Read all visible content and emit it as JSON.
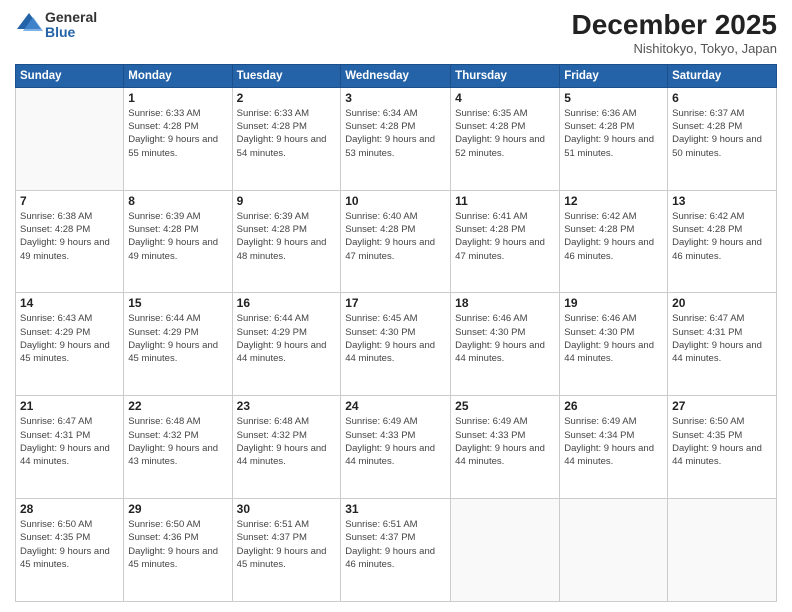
{
  "logo": {
    "general": "General",
    "blue": "Blue"
  },
  "header": {
    "month": "December 2025",
    "location": "Nishitokyo, Tokyo, Japan"
  },
  "weekdays": [
    "Sunday",
    "Monday",
    "Tuesday",
    "Wednesday",
    "Thursday",
    "Friday",
    "Saturday"
  ],
  "weeks": [
    [
      {
        "day": "",
        "sunrise": "",
        "sunset": "",
        "daylight": ""
      },
      {
        "day": "1",
        "sunrise": "Sunrise: 6:33 AM",
        "sunset": "Sunset: 4:28 PM",
        "daylight": "Daylight: 9 hours and 55 minutes."
      },
      {
        "day": "2",
        "sunrise": "Sunrise: 6:33 AM",
        "sunset": "Sunset: 4:28 PM",
        "daylight": "Daylight: 9 hours and 54 minutes."
      },
      {
        "day": "3",
        "sunrise": "Sunrise: 6:34 AM",
        "sunset": "Sunset: 4:28 PM",
        "daylight": "Daylight: 9 hours and 53 minutes."
      },
      {
        "day": "4",
        "sunrise": "Sunrise: 6:35 AM",
        "sunset": "Sunset: 4:28 PM",
        "daylight": "Daylight: 9 hours and 52 minutes."
      },
      {
        "day": "5",
        "sunrise": "Sunrise: 6:36 AM",
        "sunset": "Sunset: 4:28 PM",
        "daylight": "Daylight: 9 hours and 51 minutes."
      },
      {
        "day": "6",
        "sunrise": "Sunrise: 6:37 AM",
        "sunset": "Sunset: 4:28 PM",
        "daylight": "Daylight: 9 hours and 50 minutes."
      }
    ],
    [
      {
        "day": "7",
        "sunrise": "Sunrise: 6:38 AM",
        "sunset": "Sunset: 4:28 PM",
        "daylight": "Daylight: 9 hours and 49 minutes."
      },
      {
        "day": "8",
        "sunrise": "Sunrise: 6:39 AM",
        "sunset": "Sunset: 4:28 PM",
        "daylight": "Daylight: 9 hours and 49 minutes."
      },
      {
        "day": "9",
        "sunrise": "Sunrise: 6:39 AM",
        "sunset": "Sunset: 4:28 PM",
        "daylight": "Daylight: 9 hours and 48 minutes."
      },
      {
        "day": "10",
        "sunrise": "Sunrise: 6:40 AM",
        "sunset": "Sunset: 4:28 PM",
        "daylight": "Daylight: 9 hours and 47 minutes."
      },
      {
        "day": "11",
        "sunrise": "Sunrise: 6:41 AM",
        "sunset": "Sunset: 4:28 PM",
        "daylight": "Daylight: 9 hours and 47 minutes."
      },
      {
        "day": "12",
        "sunrise": "Sunrise: 6:42 AM",
        "sunset": "Sunset: 4:28 PM",
        "daylight": "Daylight: 9 hours and 46 minutes."
      },
      {
        "day": "13",
        "sunrise": "Sunrise: 6:42 AM",
        "sunset": "Sunset: 4:28 PM",
        "daylight": "Daylight: 9 hours and 46 minutes."
      }
    ],
    [
      {
        "day": "14",
        "sunrise": "Sunrise: 6:43 AM",
        "sunset": "Sunset: 4:29 PM",
        "daylight": "Daylight: 9 hours and 45 minutes."
      },
      {
        "day": "15",
        "sunrise": "Sunrise: 6:44 AM",
        "sunset": "Sunset: 4:29 PM",
        "daylight": "Daylight: 9 hours and 45 minutes."
      },
      {
        "day": "16",
        "sunrise": "Sunrise: 6:44 AM",
        "sunset": "Sunset: 4:29 PM",
        "daylight": "Daylight: 9 hours and 44 minutes."
      },
      {
        "day": "17",
        "sunrise": "Sunrise: 6:45 AM",
        "sunset": "Sunset: 4:30 PM",
        "daylight": "Daylight: 9 hours and 44 minutes."
      },
      {
        "day": "18",
        "sunrise": "Sunrise: 6:46 AM",
        "sunset": "Sunset: 4:30 PM",
        "daylight": "Daylight: 9 hours and 44 minutes."
      },
      {
        "day": "19",
        "sunrise": "Sunrise: 6:46 AM",
        "sunset": "Sunset: 4:30 PM",
        "daylight": "Daylight: 9 hours and 44 minutes."
      },
      {
        "day": "20",
        "sunrise": "Sunrise: 6:47 AM",
        "sunset": "Sunset: 4:31 PM",
        "daylight": "Daylight: 9 hours and 44 minutes."
      }
    ],
    [
      {
        "day": "21",
        "sunrise": "Sunrise: 6:47 AM",
        "sunset": "Sunset: 4:31 PM",
        "daylight": "Daylight: 9 hours and 44 minutes."
      },
      {
        "day": "22",
        "sunrise": "Sunrise: 6:48 AM",
        "sunset": "Sunset: 4:32 PM",
        "daylight": "Daylight: 9 hours and 43 minutes."
      },
      {
        "day": "23",
        "sunrise": "Sunrise: 6:48 AM",
        "sunset": "Sunset: 4:32 PM",
        "daylight": "Daylight: 9 hours and 44 minutes."
      },
      {
        "day": "24",
        "sunrise": "Sunrise: 6:49 AM",
        "sunset": "Sunset: 4:33 PM",
        "daylight": "Daylight: 9 hours and 44 minutes."
      },
      {
        "day": "25",
        "sunrise": "Sunrise: 6:49 AM",
        "sunset": "Sunset: 4:33 PM",
        "daylight": "Daylight: 9 hours and 44 minutes."
      },
      {
        "day": "26",
        "sunrise": "Sunrise: 6:49 AM",
        "sunset": "Sunset: 4:34 PM",
        "daylight": "Daylight: 9 hours and 44 minutes."
      },
      {
        "day": "27",
        "sunrise": "Sunrise: 6:50 AM",
        "sunset": "Sunset: 4:35 PM",
        "daylight": "Daylight: 9 hours and 44 minutes."
      }
    ],
    [
      {
        "day": "28",
        "sunrise": "Sunrise: 6:50 AM",
        "sunset": "Sunset: 4:35 PM",
        "daylight": "Daylight: 9 hours and 45 minutes."
      },
      {
        "day": "29",
        "sunrise": "Sunrise: 6:50 AM",
        "sunset": "Sunset: 4:36 PM",
        "daylight": "Daylight: 9 hours and 45 minutes."
      },
      {
        "day": "30",
        "sunrise": "Sunrise: 6:51 AM",
        "sunset": "Sunset: 4:37 PM",
        "daylight": "Daylight: 9 hours and 45 minutes."
      },
      {
        "day": "31",
        "sunrise": "Sunrise: 6:51 AM",
        "sunset": "Sunset: 4:37 PM",
        "daylight": "Daylight: 9 hours and 46 minutes."
      },
      {
        "day": "",
        "sunrise": "",
        "sunset": "",
        "daylight": ""
      },
      {
        "day": "",
        "sunrise": "",
        "sunset": "",
        "daylight": ""
      },
      {
        "day": "",
        "sunrise": "",
        "sunset": "",
        "daylight": ""
      }
    ]
  ]
}
